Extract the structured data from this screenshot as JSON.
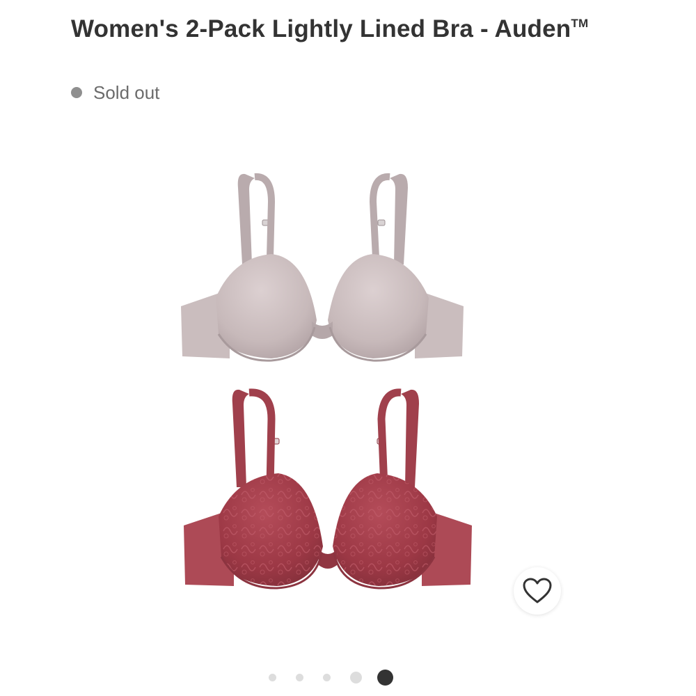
{
  "product": {
    "title": "Women's 2-Pack Lightly Lined Bra - Auden",
    "trademark": "TM",
    "status": "Sold out"
  },
  "colors": {
    "status_dot": "#8f8f8f",
    "bra_top": "#c9bcbd",
    "bra_bottom": "#a8434f",
    "active_dot": "#333333",
    "inactive_dot": "#dddddd"
  },
  "image": {
    "description_icon": "bra-two-pack-image"
  },
  "favorite": {
    "icon": "heart-icon"
  },
  "carousel": {
    "total": 5,
    "active_index": 5
  }
}
